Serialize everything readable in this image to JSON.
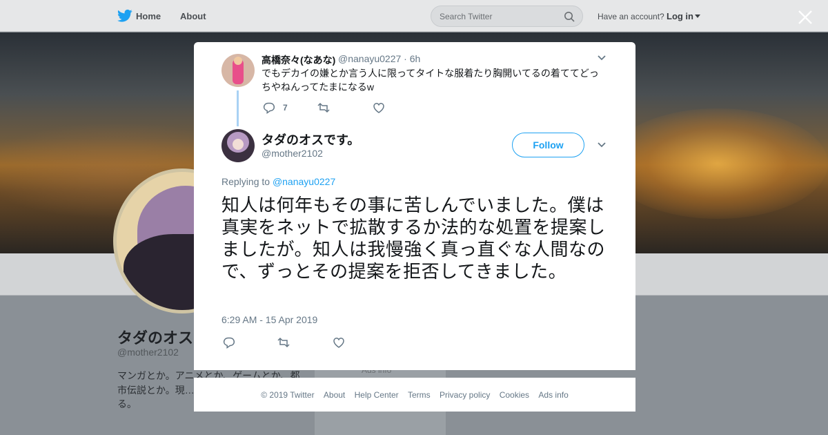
{
  "topbar": {
    "nav_home": "Home",
    "nav_about": "About",
    "search_placeholder": "Search Twitter",
    "have_account": "Have an account?",
    "login": "Log in"
  },
  "background_profile": {
    "name": "タダのオス",
    "handle": "@mother2102",
    "bio": "マンガとか。アニメとか、ゲームとか、都市伝説とか。現…じないかは自分次…をする。",
    "ads_info": "Ads info"
  },
  "parent_tweet": {
    "name": "高橋奈々(なあな)",
    "meta": "@nanayu0227 · 6h",
    "text": "でもデカイの嫌とか言う人に限ってタイトな服着たり胸開いてるの着ててどっちやねんってたまになるw",
    "reply_count": "7"
  },
  "main_tweet": {
    "name": "タダのオスです。",
    "handle": "@mother2102",
    "follow_label": "Follow",
    "replying_prefix": "Replying to",
    "replying_mention": "@nanayu0227",
    "text": "知人は何年もその事に苦しんでいました。僕は真実をネットで拡散するか法的な処置を提案しましたが。知人は我慢強く真っ直ぐな人間なので、ずっとその提案を拒否してきました。",
    "timestamp": "6:29 AM - 15 Apr 2019"
  },
  "footer": {
    "copyright": "© 2019 Twitter",
    "about": "About",
    "help": "Help Center",
    "terms": "Terms",
    "privacy": "Privacy policy",
    "cookies": "Cookies",
    "ads": "Ads info"
  },
  "colors": {
    "accent": "#1da1f2",
    "thread_line": "#a9d2f4",
    "secondary_text": "#657786"
  },
  "icons": [
    "twitter-bird-icon",
    "search-icon",
    "caret-down-icon",
    "close-icon",
    "chevron-down-icon",
    "reply-icon",
    "retweet-icon",
    "like-icon"
  ]
}
